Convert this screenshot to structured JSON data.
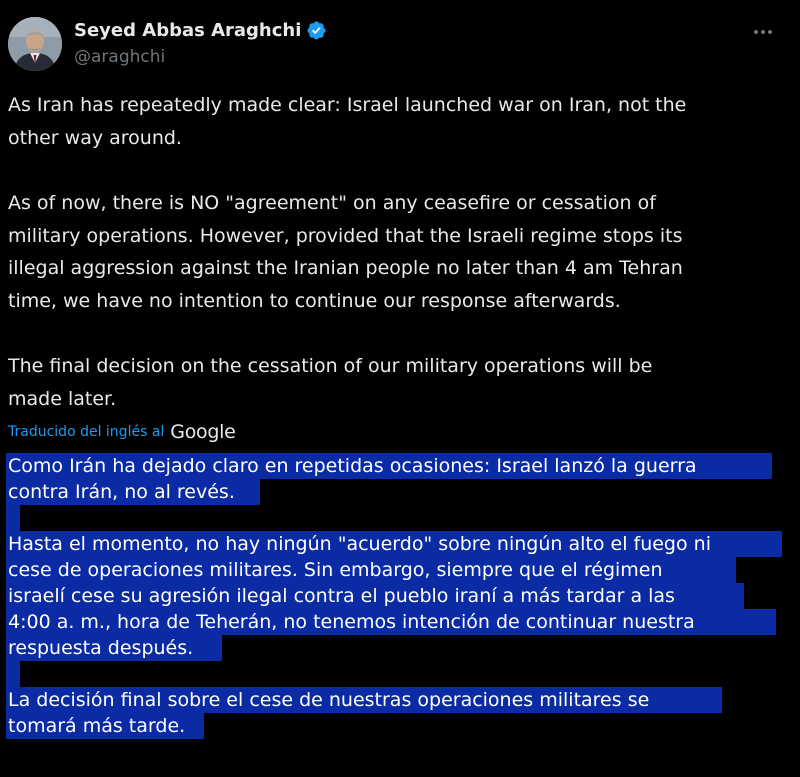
{
  "author": {
    "name": "Seyed Abbas Araghchi",
    "handle": "@araghchi",
    "verified_color": "#1d9bf0",
    "avatar_icon": "portrait-photo"
  },
  "menu": {
    "icon": "more-icon"
  },
  "tweet": {
    "paragraphs": [
      "As Iran has repeatedly made clear: Israel launched war on Iran, not the\nother way around.",
      "As of now, there is NO \"agreement\" on any ceasefire or cessation of\nmilitary operations. However, provided that the Israeli regime stops its\nillegal aggression against the Iranian people no later than 4 am Tehran\ntime, we have no intention to continue our response afterwards.",
      "The final decision on the cessation of our military operations will be\nmade later."
    ]
  },
  "translation": {
    "note": "Traducido del inglés al",
    "provider": "Google",
    "paragraphs": [
      "Como Irán ha dejado claro en repetidas ocasiones: Israel lanzó la guerra\ncontra Irán, no al revés.",
      "Hasta el momento, no hay ningún \"acuerdo\" sobre ningún alto el fuego ni\ncese de operaciones militares. Sin embargo, siempre que el régimen\nisraelí cese su agresión ilegal contra el pueblo iraní a más tardar a las\n4:00 a. m., hora de Teherán, no tenemos intención de continuar nuestra\nrespuesta después.",
      "La decisión final sobre el cese de nuestras operaciones militares se\ntomará más tarde."
    ],
    "selection_color": "#0a2ba4"
  }
}
